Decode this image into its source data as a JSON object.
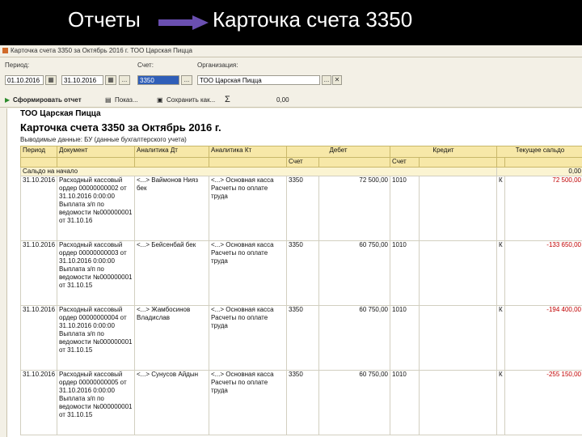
{
  "slide": {
    "title_left": "Отчеты",
    "title_right": "Карточка счета 3350"
  },
  "window": {
    "title": "Карточка счета 3350 за Октябрь 2016 г. ТОО Царская Пицца"
  },
  "params": {
    "period_label": "Период:",
    "date_from": "01.10.2016",
    "date_to": "31.10.2016",
    "more": "...",
    "account_label": "Счет:",
    "account_value": "3350",
    "org_label": "Организация:",
    "org_value": "ТОО Царская Пицца"
  },
  "toolbar": {
    "generate": "Сформировать отчет",
    "show": "Показ...",
    "save_as": "Сохранить как...",
    "sum_symbol": "Σ",
    "sum_value": "0,00"
  },
  "report": {
    "org": "ТОО Царская Пицца",
    "title": "Карточка счета 3350 за Октябрь 2016 г.",
    "subtitle": "Выводимые данные: БУ (данные бухгалтерского учета)"
  },
  "columns": {
    "period": "Период",
    "document": "Документ",
    "an_dt": "Аналитика Дт",
    "an_kt": "Аналитика Кт",
    "debit": "Дебет",
    "credit": "Кредит",
    "balance": "Текущее сальдо",
    "acc": "Счет"
  },
  "opening": {
    "label": "Сальдо на начало",
    "value": "0,00"
  },
  "rows": [
    {
      "date": "31.10.2016",
      "doc": "Расходный кассовый ордер 00000000002 от 31.10.2016 0:00:00 Выплата з/п по ведомости №000000001 от 31.10.16",
      "an_dt": "<...> Ваймонов Нияз бек",
      "an_kt": "<...> Основная касса Расчеты по оплате труда",
      "acc_dt": "3350",
      "amount": "72 500,00",
      "acc_kt": "1010",
      "dir": "К",
      "balance": "72 500,00"
    },
    {
      "date": "31.10.2016",
      "doc": "Расходный кассовый ордер 00000000003 от 31.10.2016 0:00:00 Выплата з/п по ведомости №000000001 от 31.10.15",
      "an_dt": "<...> Бейсенбай бек",
      "an_kt": "<...> Основная касса Расчеты по оплате труда",
      "acc_dt": "3350",
      "amount": "60 750,00",
      "acc_kt": "1010",
      "dir": "К",
      "balance": "-133 650,00"
    },
    {
      "date": "31.10.2016",
      "doc": "Расходный кассовый ордер 00000000004 от 31.10.2016 0:00:00 Выплата з/п по ведомости №000000001 от 31.10.15",
      "an_dt": "<...> Жамбосинов Владислав",
      "an_kt": "<...> Основная касса Расчеты по оплате труда",
      "acc_dt": "3350",
      "amount": "60 750,00",
      "acc_kt": "1010",
      "dir": "К",
      "balance": "-194 400,00"
    },
    {
      "date": "31.10.2016",
      "doc": "Расходный кассовый ордер 00000000005 от 31.10.2016 0:00:00 Выплата з/п по ведомости №000000001 от 31.10.15",
      "an_dt": "<...> Сунусов Айдын",
      "an_kt": "<...> Основная касса Расчеты по оплате труда",
      "acc_dt": "3350",
      "amount": "60 750,00",
      "acc_kt": "1010",
      "dir": "К",
      "balance": "-255 150,00"
    }
  ]
}
